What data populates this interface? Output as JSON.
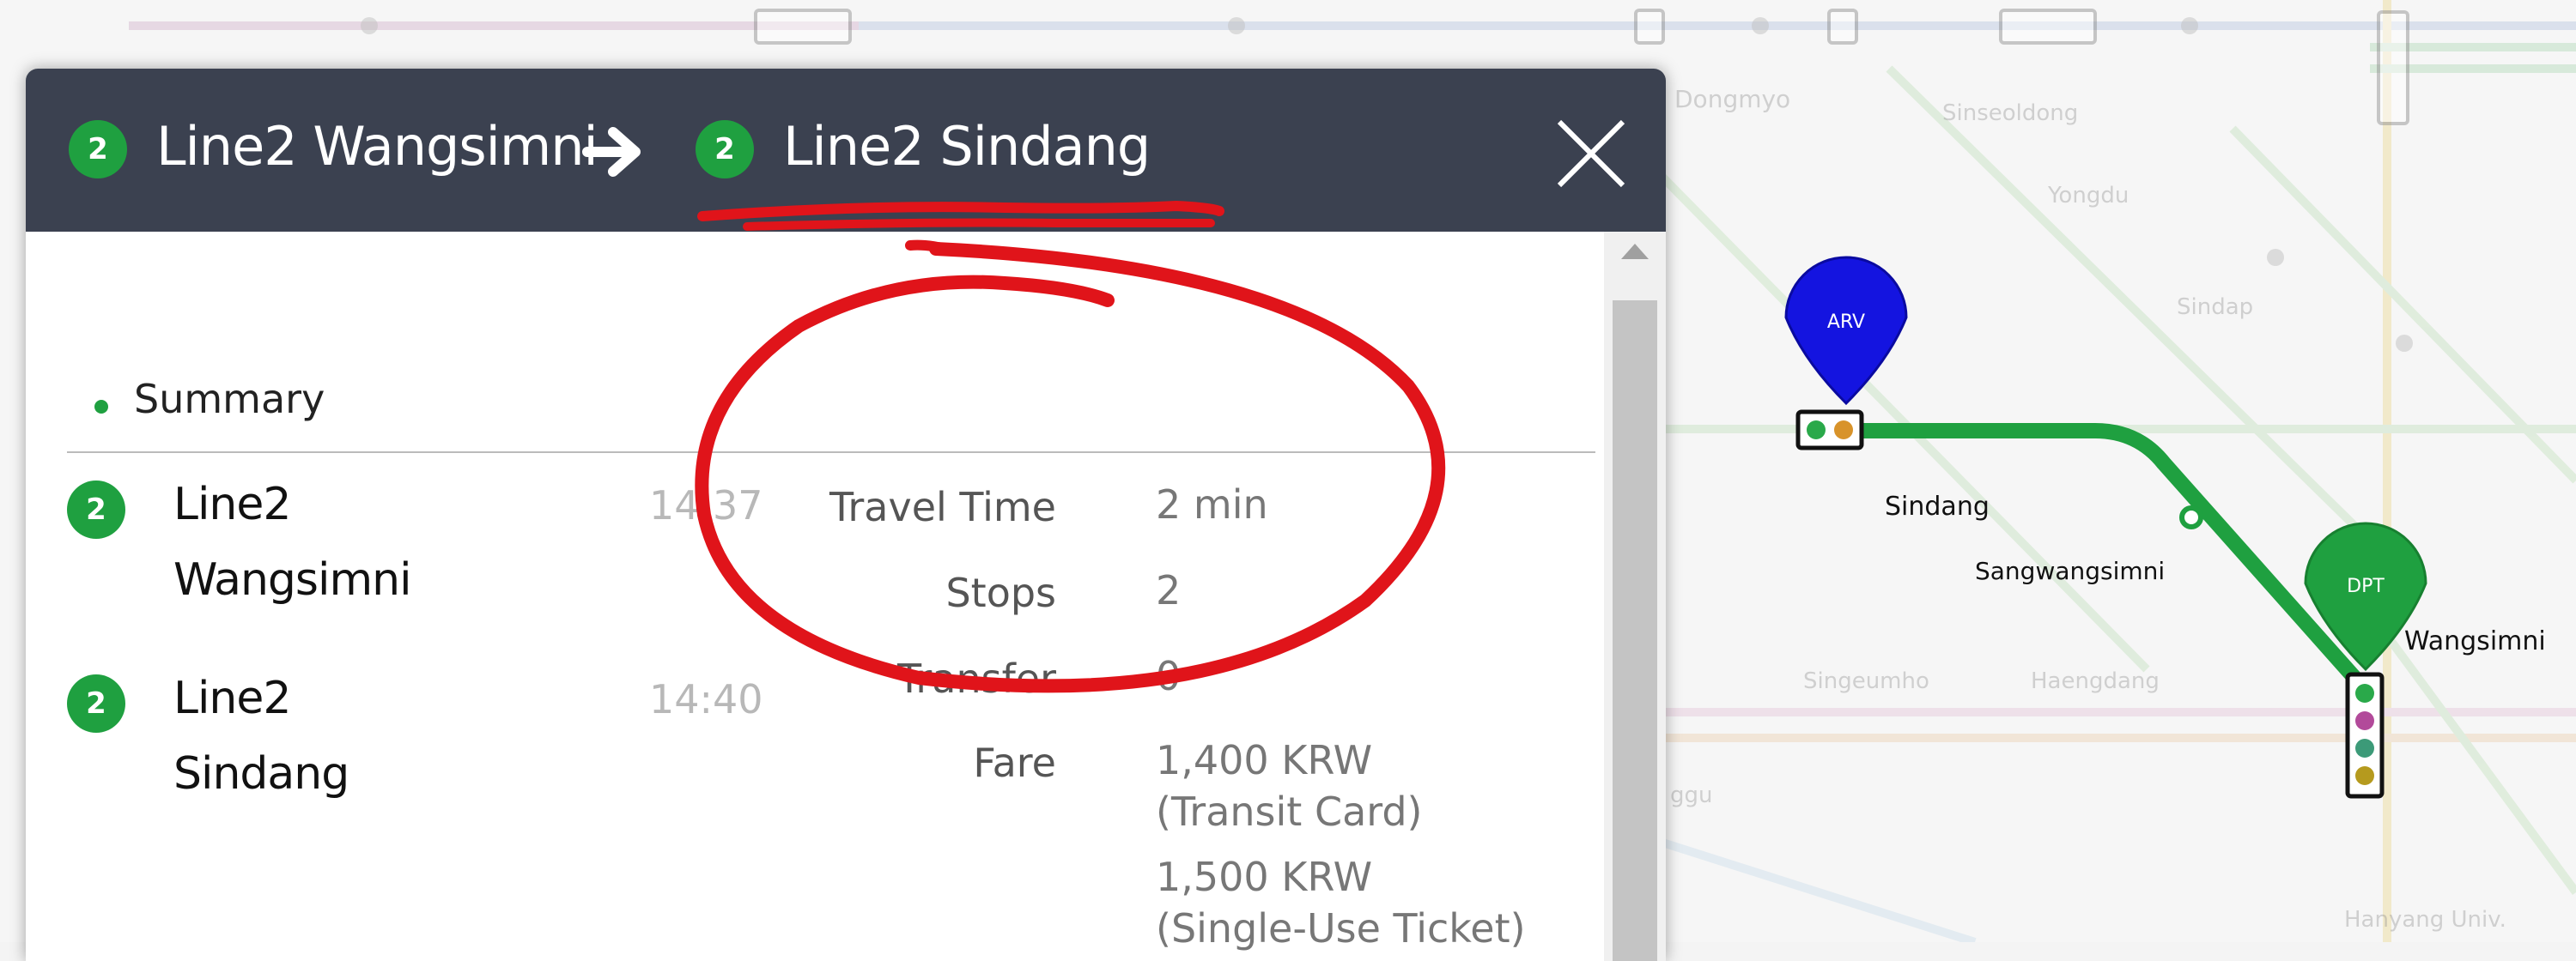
{
  "header": {
    "origin_badge": "2",
    "origin_label": "Line2 Wangsimni",
    "destination_badge": "2",
    "destination_label": "Line2 Sindang",
    "close_icon": "close-icon",
    "arrow_icon": "arrow-right-icon"
  },
  "summary": {
    "title": "Summary"
  },
  "stops": [
    {
      "badge": "2",
      "line": "Line2",
      "name": "Wangsimni",
      "time": "14:37"
    },
    {
      "badge": "2",
      "line": "Line2",
      "name": "Sindang",
      "time": "14:40"
    }
  ],
  "details": [
    {
      "label": "Travel Time",
      "value": "2 min"
    },
    {
      "label": "Stops",
      "value": "2"
    },
    {
      "label": "Transfer",
      "value": "0"
    },
    {
      "label": "Fare",
      "value": "1,400 KRW",
      "note": "(Transit Card)",
      "value2": "1,500 KRW",
      "note2": "(Single-Use Ticket)"
    }
  ],
  "map": {
    "stations": {
      "sindang": "Sindang",
      "sangwangsimni": "Sangwangsimni",
      "wangsimni": "Wangsimni",
      "dongmyo": "Dongmyo",
      "sinseoldong": "Sinseoldong",
      "yongdu": "Yongdu",
      "sindap": "Sindap",
      "singeumho": "Singeumho",
      "haengdang": "Haengdang",
      "hanyang_univ": "Hanyang Univ.",
      "partial_left": "ggu"
    },
    "arrival_pin": "ARV",
    "departure_pin": "DPT",
    "colors": {
      "line2": "#1fa040",
      "arrival": "#1414e0",
      "departure": "#1fa040"
    }
  },
  "colors": {
    "header_bg": "#3b4150",
    "line2": "#1fa040",
    "annotation": "#e0141a"
  }
}
